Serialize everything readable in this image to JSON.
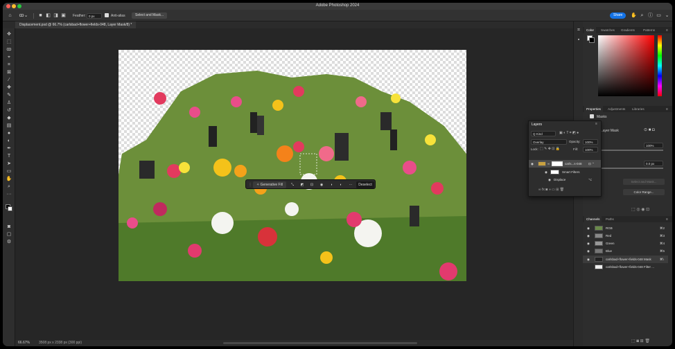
{
  "app": {
    "title": "Adobe Photoshop 2024",
    "share_label": "Share"
  },
  "options_bar": {
    "feather_label": "Feather:",
    "feather_value": "0 px",
    "antialias_label": "Anti-alias",
    "select_mask_label": "Select and Mask..."
  },
  "document": {
    "tab_title": "Displacement.psd @ 66.7% (carlsbad+flower+fields-048, Layer Mask/8) *",
    "zoom": "66.67%",
    "dimensions": "3508 px x 2338 px (300 ppi)"
  },
  "context_bar": {
    "generative_fill": "Generative Fill",
    "deselect": "Deselect"
  },
  "color_panel": {
    "tabs": [
      "Color",
      "Swatches",
      "Gradients",
      "Patterns"
    ]
  },
  "properties_panel": {
    "tabs": [
      "Properties",
      "Adjustments",
      "Libraries"
    ],
    "type_label": "Masks",
    "mask_label": "Layer Mask",
    "density_value": "100%",
    "feather_value": "0.0 px",
    "select_mask_button": "Select and Mask...",
    "color_range_button": "Color Range..."
  },
  "layers_panel": {
    "title": "Layers",
    "kind_label": "Q Kind",
    "blend_mode": "Overlay",
    "opacity_label": "Opacity:",
    "opacity_value": "100%",
    "lock_label": "Lock:",
    "fill_label": "Fill:",
    "fill_value": "100%",
    "layer_name": "carls...s-048",
    "smart_filters": "Smart Filters",
    "displace": "Displace"
  },
  "channels_panel": {
    "tabs": [
      "Channels",
      "Paths"
    ],
    "channels": [
      {
        "name": "RGB",
        "shortcut": "⌘2"
      },
      {
        "name": "Red",
        "shortcut": "⌘3"
      },
      {
        "name": "Green",
        "shortcut": "⌘4"
      },
      {
        "name": "Blue",
        "shortcut": "⌘5"
      },
      {
        "name": "carlsbad+flower+fields-048 Mask",
        "shortcut": "⌘\\"
      },
      {
        "name": "carlsbad+flower+fields-048 Filter ...",
        "shortcut": ""
      }
    ]
  },
  "colors": {
    "accent_blue": "#1473e6",
    "panel_bg": "#2d2d2d",
    "canvas_bg": "#262626"
  }
}
